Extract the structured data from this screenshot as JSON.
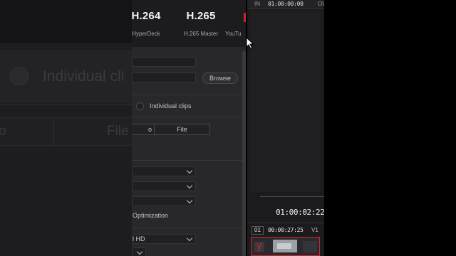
{
  "zoom_background": {
    "individual_clips_text": "Individual cli",
    "segment_left_text": "o",
    "segment_right_text": "File"
  },
  "render_presets": [
    {
      "codec": "H.264",
      "name": "HyperDeck"
    },
    {
      "codec": "H.265",
      "name": "H.265 Master"
    },
    {
      "codec": "",
      "name": "YouTu"
    }
  ],
  "location": {
    "browse_label": "Browse"
  },
  "render_mode": {
    "individual_clips_label": "Individual clips"
  },
  "export_segment": {
    "left_label": "o",
    "right_label": "File"
  },
  "optimization_label": "Optimization",
  "resolution_dropdown_value": "l HD",
  "viewer": {
    "in_label": "IN",
    "in_timecode": "01:00:00:00",
    "out_label": "OU",
    "current_timecode": "01:00:02:22",
    "clip_number": "01",
    "clip_duration": "00:00:27:25",
    "clip_track": "V1"
  },
  "colors": {
    "accent_red": "#d0242a",
    "panel_bg": "#28282b",
    "viewer_bg": "#1b1b1d"
  }
}
